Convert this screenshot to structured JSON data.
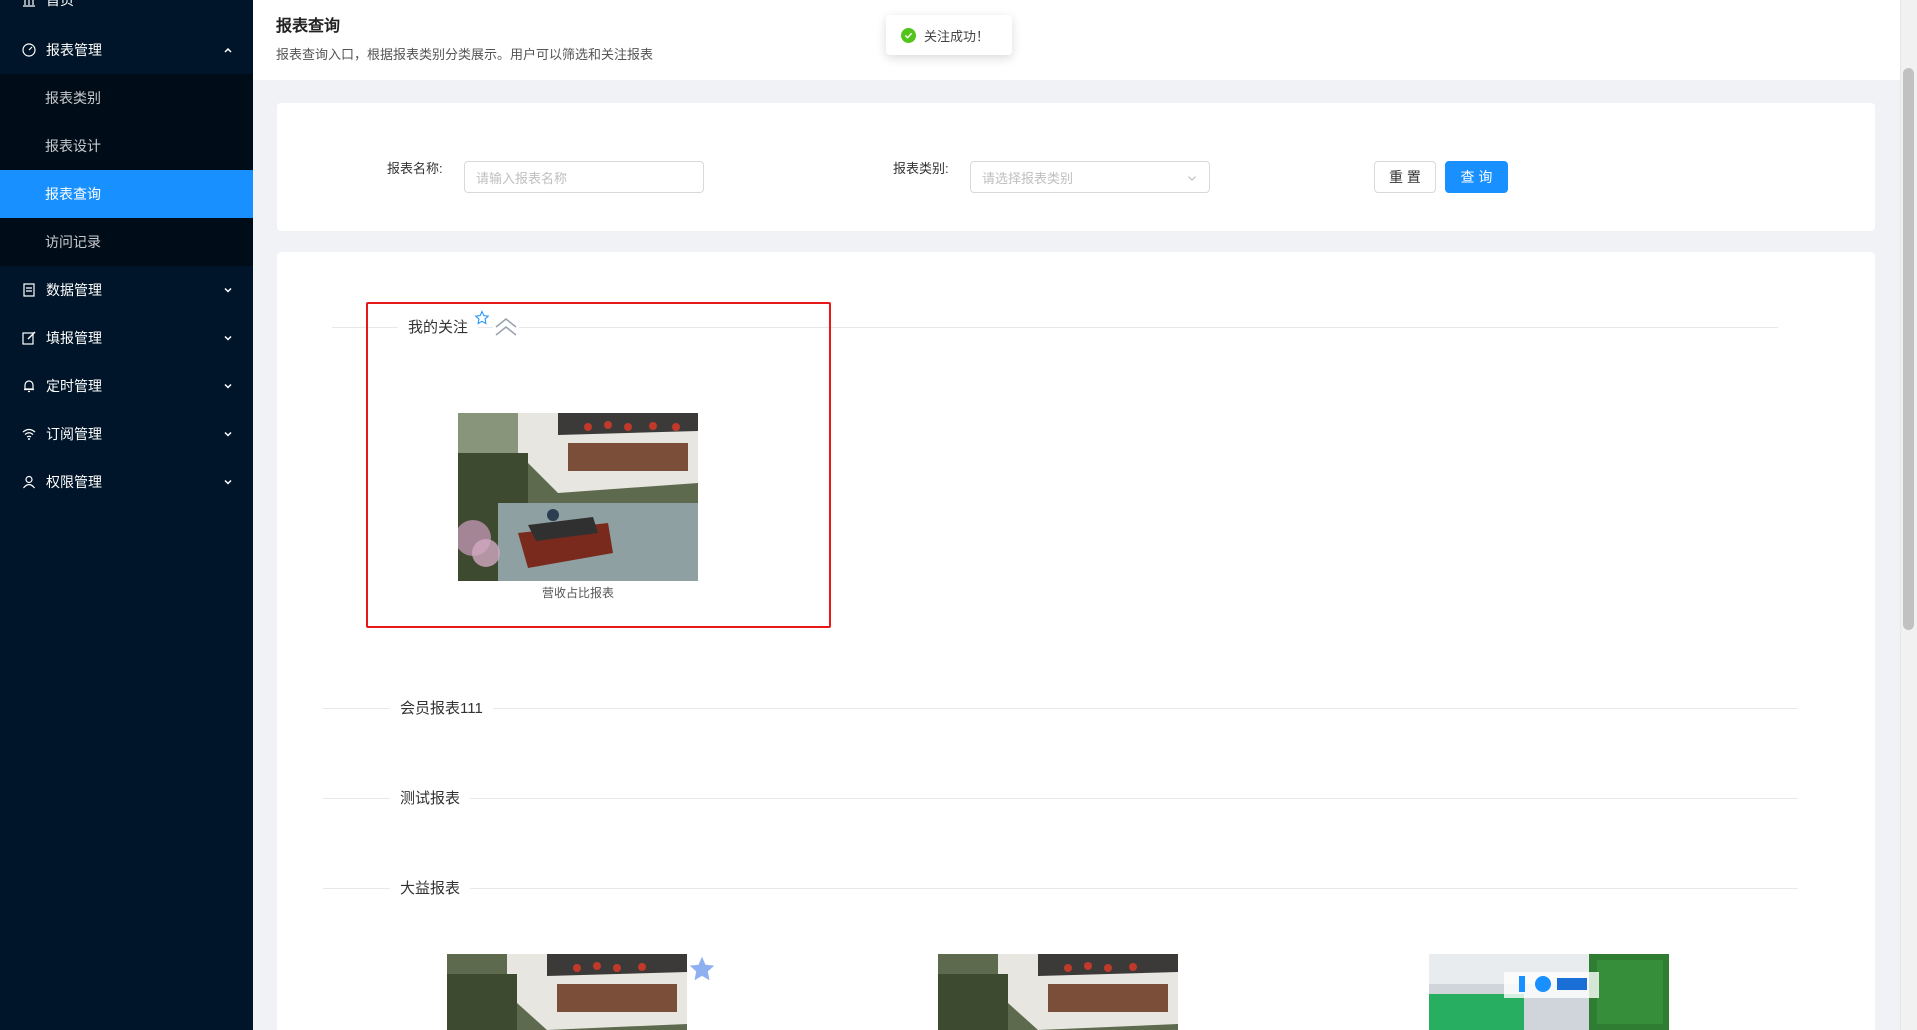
{
  "sidebar": {
    "top_item": {
      "label": "首页",
      "icon": "bank-icon"
    },
    "menus": [
      {
        "label": "报表管理",
        "icon": "dashboard-icon",
        "expanded": true
      },
      {
        "label": "数据管理",
        "icon": "list-icon",
        "expanded": false
      },
      {
        "label": "填报管理",
        "icon": "edit-icon",
        "expanded": false
      },
      {
        "label": "定时管理",
        "icon": "bell-icon",
        "expanded": false
      },
      {
        "label": "订阅管理",
        "icon": "wifi-icon",
        "expanded": false
      },
      {
        "label": "权限管理",
        "icon": "user-icon",
        "expanded": false
      }
    ],
    "submenu": [
      {
        "label": "报表类别",
        "active": false
      },
      {
        "label": "报表设计",
        "active": false
      },
      {
        "label": "报表查询",
        "active": true
      },
      {
        "label": "访问记录",
        "active": false
      }
    ]
  },
  "header": {
    "title": "报表查询",
    "description": "报表查询入口，根据报表类别分类展示。用户可以筛选和关注报表"
  },
  "toast": {
    "text": "关注成功！"
  },
  "filter": {
    "name_label": "报表名称:",
    "name_placeholder": "请输入报表名称",
    "category_label": "报表类别:",
    "category_placeholder": "请选择报表类别",
    "reset_label": "重 置",
    "query_label": "查 询"
  },
  "sections": {
    "favorites": {
      "title": "我的关注",
      "items": [
        {
          "caption": "营收占比报表"
        }
      ]
    },
    "groups": [
      {
        "title": "会员报表111"
      },
      {
        "title": "测试报表"
      },
      {
        "title": "大益报表"
      }
    ]
  },
  "colors": {
    "sidebar_bg": "#001529",
    "submenu_bg": "#000c17",
    "primary": "#1890ff",
    "highlight_box": "#e81818",
    "success": "#52c41a"
  }
}
